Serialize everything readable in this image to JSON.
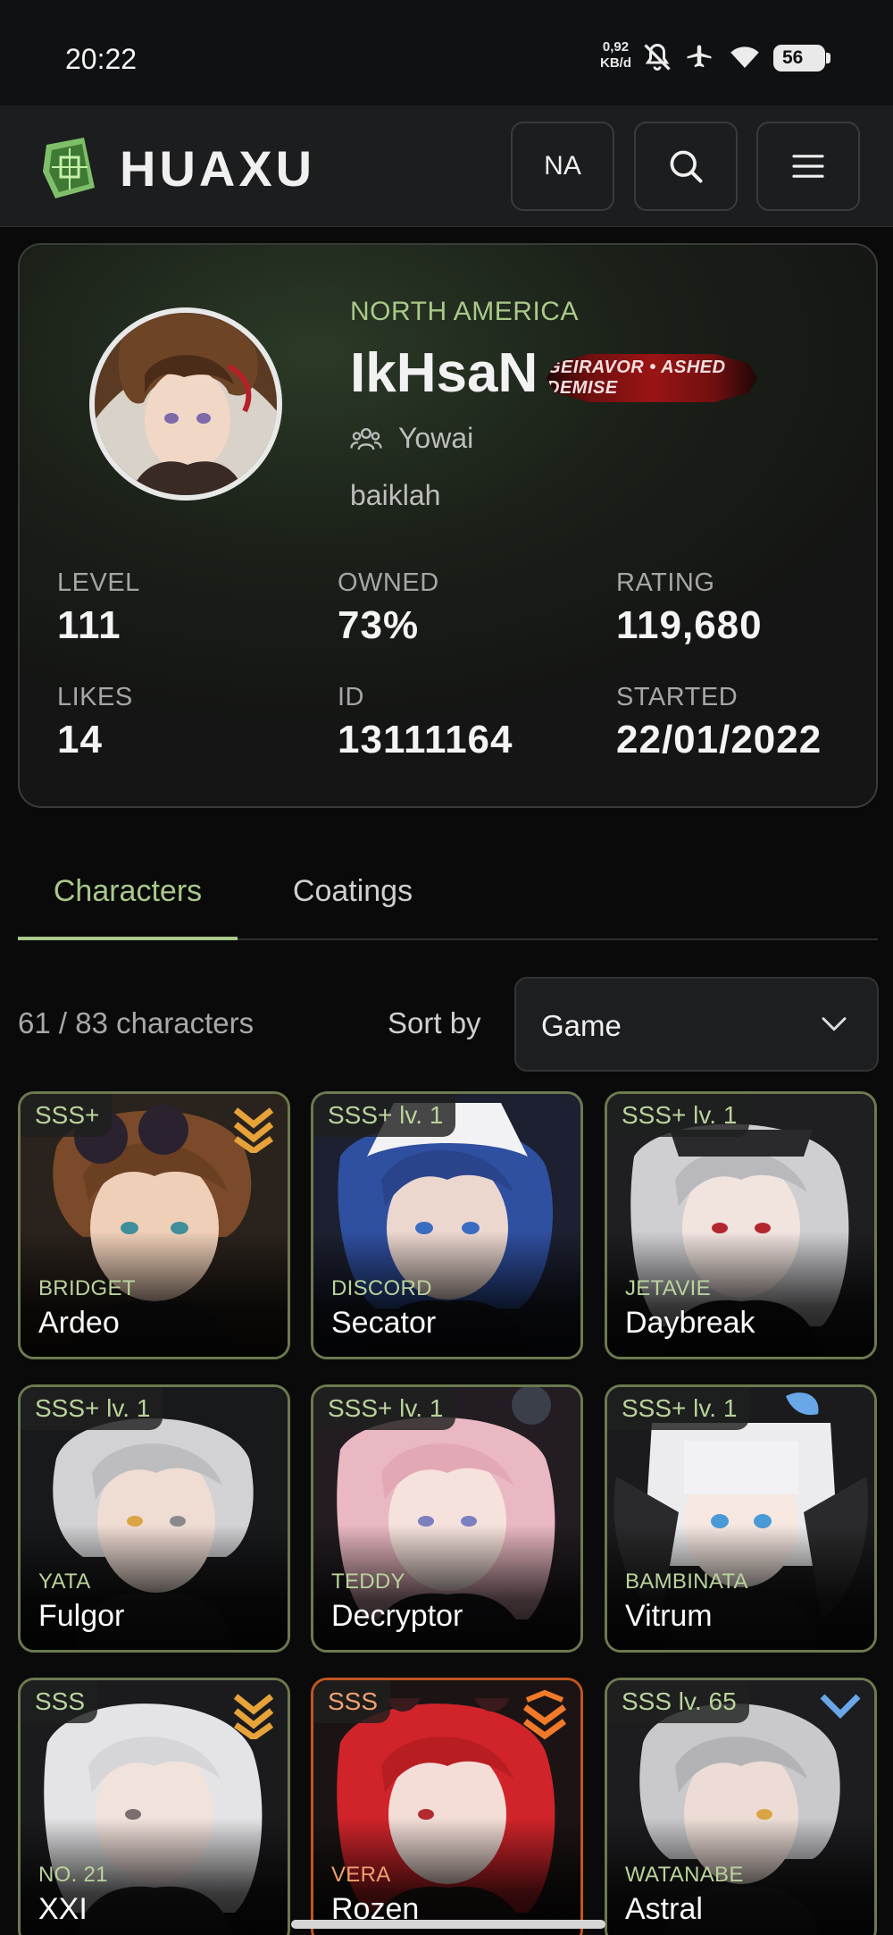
{
  "status_bar": {
    "time": "20:22",
    "net_speed_value": "0,92",
    "net_speed_unit": "KB/d",
    "battery": "56",
    "icons": [
      "mute-icon",
      "airplane-icon",
      "wifi-icon",
      "battery-icon"
    ]
  },
  "header": {
    "logo_text": "HUAXU",
    "region_button": "NA",
    "icons": [
      "logo-icon",
      "search-icon",
      "menu-icon"
    ]
  },
  "profile": {
    "region": "NORTH AMERICA",
    "name": "IkHsaN",
    "title_badge": "GEIRAVOR • ASHED DEMISE",
    "guild": "Yowai",
    "bio": "baiklah",
    "stats": [
      {
        "label": "LEVEL",
        "value": "111"
      },
      {
        "label": "OWNED",
        "value": "73%"
      },
      {
        "label": "RATING",
        "value": "119,680"
      },
      {
        "label": "LIKES",
        "value": "14"
      },
      {
        "label": "ID",
        "value": "13111164"
      },
      {
        "label": "STARTED",
        "value": "22/01/2022"
      }
    ]
  },
  "tabs": [
    {
      "label": "Characters",
      "active": true
    },
    {
      "label": "Coatings",
      "active": false
    }
  ],
  "toolbar": {
    "count": "61 / 83 characters",
    "sort_label": "Sort by",
    "sort_value": "Game"
  },
  "characters": [
    {
      "rank": "SSS+",
      "frame": "BRIDGET",
      "name": "Ardeo",
      "tier_icon": "gold-chevron-icon",
      "accent": "#6b7a4f"
    },
    {
      "rank": "SSS+ lv. 1",
      "frame": "DISCORD",
      "name": "Secator",
      "tier_icon": "",
      "accent": "#6b7a4f"
    },
    {
      "rank": "SSS+ lv. 1",
      "frame": "JETAVIE",
      "name": "Daybreak",
      "tier_icon": "",
      "accent": "#6b7a4f"
    },
    {
      "rank": "SSS+ lv. 1",
      "frame": "YATA",
      "name": "Fulgor",
      "tier_icon": "",
      "accent": "#6b7a4f"
    },
    {
      "rank": "SSS+ lv. 1",
      "frame": "TEDDY",
      "name": "Decryptor",
      "tier_icon": "",
      "accent": "#6b7a4f"
    },
    {
      "rank": "SSS+ lv. 1",
      "frame": "BAMBINATA",
      "name": "Vitrum",
      "tier_icon": "",
      "accent": "#6b7a4f"
    },
    {
      "rank": "SSS",
      "frame": "NO. 21",
      "name": "XXI",
      "tier_icon": "gold-chevron-icon",
      "accent": "#6b7a4f"
    },
    {
      "rank": "SSS",
      "frame": "VERA",
      "name": "Rozen",
      "tier_icon": "orange-chevron-icon",
      "accent": "#c2551f"
    },
    {
      "rank": "SSS lv. 65",
      "frame": "WATANABE",
      "name": "Astral",
      "tier_icon": "blue-chevron-icon",
      "accent": "#6b7a4f"
    }
  ],
  "colors": {
    "accent_green": "#a9c98a",
    "background": "#0a0a0a",
    "card_border": "#6b7a4f",
    "card_border_red": "#c2551f"
  }
}
